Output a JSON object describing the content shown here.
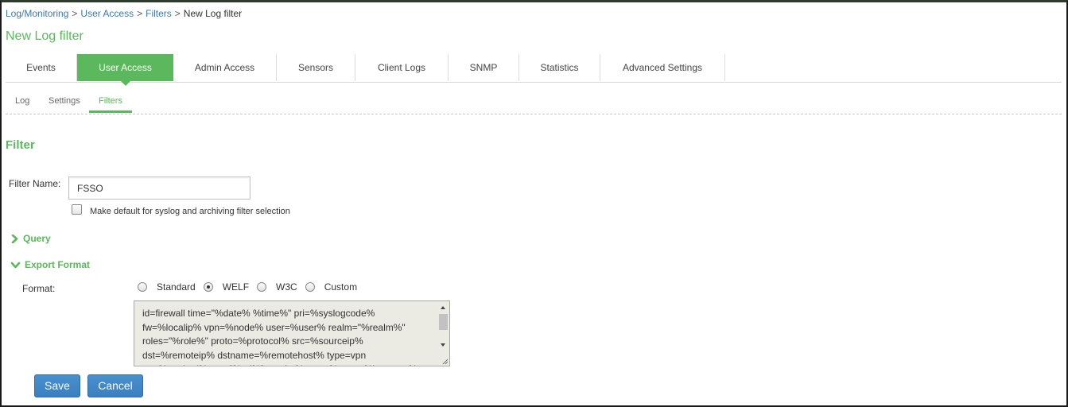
{
  "breadcrumb": {
    "items": [
      "Log/Monitoring",
      "User Access",
      "Filters"
    ],
    "separator": ">",
    "current": "New Log filter"
  },
  "page": {
    "title": "New Log filter"
  },
  "tabs": [
    {
      "label": "Events",
      "active": false
    },
    {
      "label": "User Access",
      "active": true
    },
    {
      "label": "Admin Access",
      "active": false
    },
    {
      "label": "Sensors",
      "active": false
    },
    {
      "label": "Client Logs",
      "active": false
    },
    {
      "label": "SNMP",
      "active": false
    },
    {
      "label": "Statistics",
      "active": false
    },
    {
      "label": "Advanced Settings",
      "active": false
    }
  ],
  "subtabs": [
    {
      "label": "Log",
      "active": false
    },
    {
      "label": "Settings",
      "active": false
    },
    {
      "label": "Filters",
      "active": true
    }
  ],
  "section": {
    "title": "Filter"
  },
  "filter_name": {
    "label": "Filter Name:",
    "value": "FSSO"
  },
  "default_checkbox": {
    "label": "Make default for syslog and archiving filter selection",
    "checked": false
  },
  "query": {
    "label": "Query",
    "expanded": false,
    "icon": "chevron-right-icon"
  },
  "export_format": {
    "label": "Export Format",
    "expanded": true,
    "icon": "chevron-down-icon",
    "format_label": "Format:",
    "options": [
      {
        "label": "Standard",
        "checked": false
      },
      {
        "label": "WELF",
        "checked": true
      },
      {
        "label": "W3C",
        "checked": false
      },
      {
        "label": "Custom",
        "checked": false
      }
    ],
    "template_text": "id=firewall time=\"%date% %time%\" pri=%syslogcode%\nfw=%localip% vpn=%node% user=%user% realm=\"%realm%\"\nroles=\"%role%\" proto=%protocol% src=%sourceip%\ndst=%remoteip% dstname=%remotehost% type=vpn\nop=%method% arg=\"%uri%\" result=%status% sent=%bytesent%"
  },
  "buttons": {
    "save": "Save",
    "cancel": "Cancel"
  },
  "colors": {
    "accent_green": "#5cb85c",
    "link_blue": "#3a7ab5",
    "button_blue": "#3a7fbf",
    "textarea_bg": "#ebebe4"
  }
}
